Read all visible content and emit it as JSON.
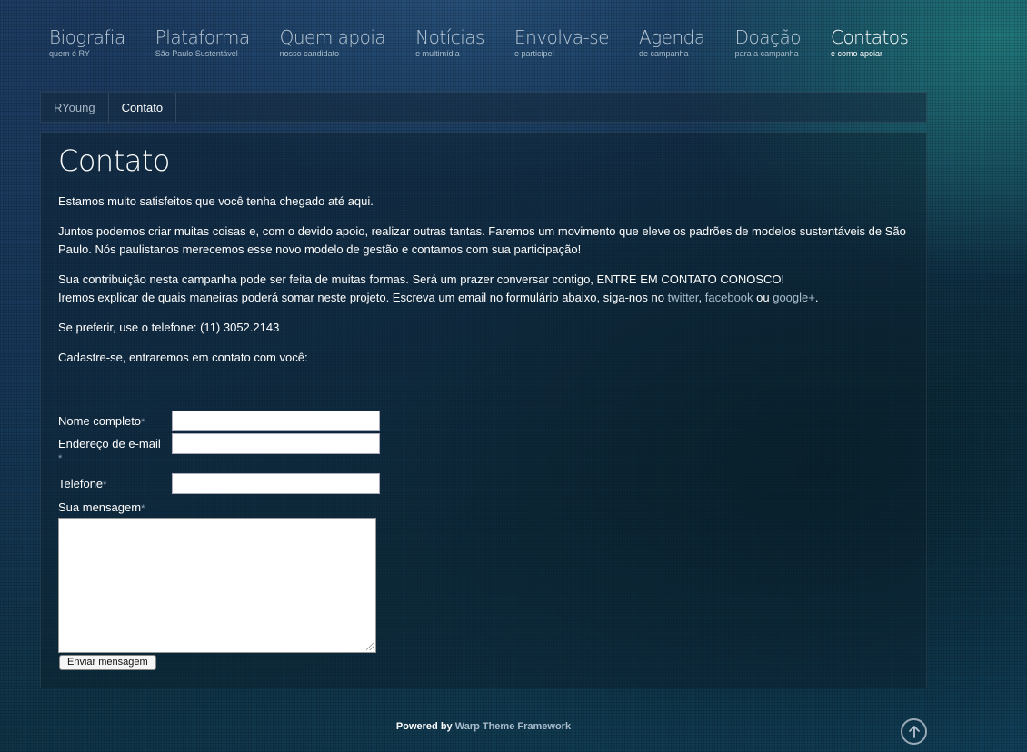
{
  "nav": {
    "items": [
      {
        "title": "Biografia",
        "sub": "quem é RY"
      },
      {
        "title": "Plataforma",
        "sub": "São Paulo Sustentável"
      },
      {
        "title": "Quem apoia",
        "sub": "nosso candidato"
      },
      {
        "title": "Notícias",
        "sub": "e multimídia"
      },
      {
        "title": "Envolva-se",
        "sub": "e participe!"
      },
      {
        "title": "Agenda",
        "sub": "de campanha"
      },
      {
        "title": "Doação",
        "sub": "para a campanha"
      },
      {
        "title": "Contatos",
        "sub": "e como apoiar"
      }
    ],
    "active_index": 7
  },
  "breadcrumb": {
    "home": "RYoung",
    "current": "Contato"
  },
  "page": {
    "title": "Contato",
    "p1": "Estamos muito satisfeitos que você tenha chegado até aqui.",
    "p2": "Juntos podemos criar muitas coisas e, com o devido apoio, realizar outras tantas. Faremos um movimento que eleve os padrões de modelos sustentáveis de São Paulo. Nós paulistanos merecemos esse novo modelo de gestão e contamos com sua participação!",
    "p3_line1": "Sua contribuição nesta campanha pode ser feita de muitas formas. Será um prazer conversar contigo, ENTRE EM CONTATO CONOSCO!",
    "p3_line2_a": "Iremos explicar de quais maneiras poderá somar neste projeto. Escreva um email no formulário abaixo, siga-nos no ",
    "twitter": "twitter",
    "sep1": ", ",
    "facebook": "facebook",
    "sep2": " ou ",
    "google": "google+",
    "end": ".",
    "p4": "Se preferir, use o telefone: (11) 3052.2143",
    "p5": "Cadastre-se, entraremos em contato com você:"
  },
  "form": {
    "name_label": "Nome completo",
    "email_label": "Endereço de e-mail",
    "phone_label": "Telefone",
    "message_label": "Sua mensagem",
    "required_mark": "*",
    "name_value": "",
    "email_value": "",
    "phone_value": "",
    "message_value": "",
    "submit_label": "Enviar mensagem"
  },
  "footer": {
    "prefix": "Powered by ",
    "link": "Warp Theme Framework"
  },
  "colors": {
    "link": "#a9bccb",
    "accent": "#2aa596"
  },
  "icons": {
    "to_top": "arrow-up-circle-icon"
  }
}
